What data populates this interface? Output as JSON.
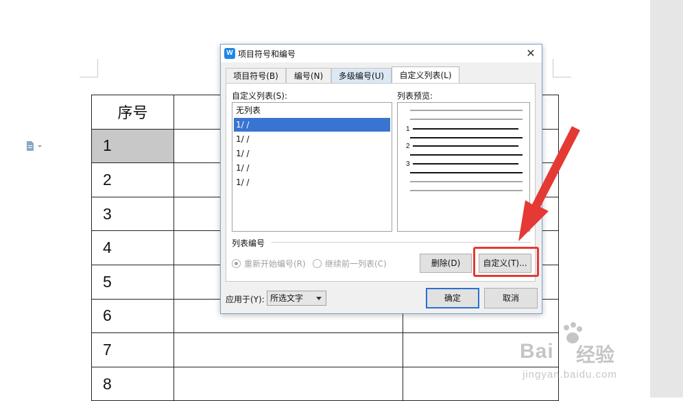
{
  "dialog": {
    "title": "项目符号和编号",
    "tabs": [
      "项目符号(B)",
      "编号(N)",
      "多级编号(U)",
      "自定义列表(L)"
    ],
    "custom_list_label": "自定义列表(S):",
    "list_items": [
      "无列表",
      "1/  /",
      "1/  /",
      "1/  /",
      "1/  /",
      "1/  /"
    ],
    "preview_label": "列表预览:",
    "preview_numbers": [
      "1",
      "2",
      "3"
    ],
    "list_numbering_label": "列表编号",
    "radio_restart": "重新开始编号(R)",
    "radio_continue": "继续前一列表(C)",
    "delete_button": "删除(D)",
    "customize_button": "自定义(T)...",
    "apply_to_label": "应用于(Y):",
    "apply_to_value": "所选文字",
    "ok_button": "确定",
    "cancel_button": "取消",
    "close_symbol": "✕",
    "app_icon_letter": "W"
  },
  "table": {
    "header": "序号",
    "rows": [
      "1",
      "2",
      "3",
      "4",
      "5",
      "6",
      "7",
      "8"
    ]
  },
  "watermark": {
    "logo": "Bai",
    "logo_suffix": "经验",
    "url": "jingyan.baidu.com"
  },
  "colors": {
    "selection": "#3874d0",
    "arrow": "#e53935",
    "accent": "#1e88e5"
  }
}
